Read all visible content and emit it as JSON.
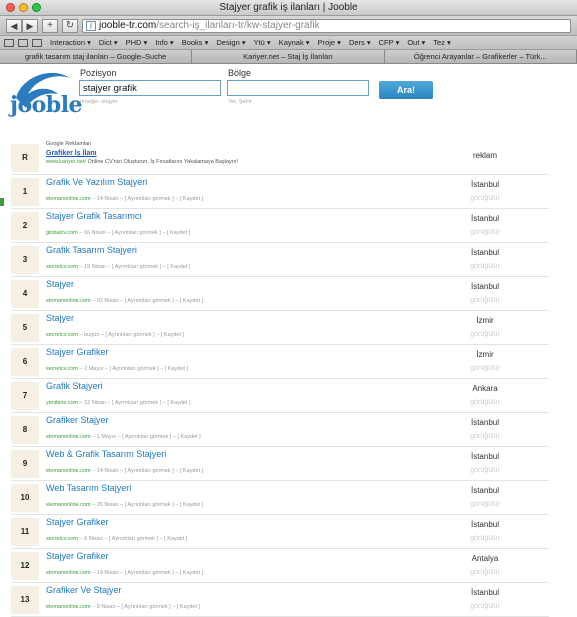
{
  "window": {
    "title": "Stajyer grafik iş ilanları | Jooble"
  },
  "toolbar": {
    "url_domain": "jooble-tr.com",
    "url_path": "/search-iş_ilanları-tr/kw-stajyer-grafik",
    "back": "◀",
    "forward": "▶",
    "add": "+",
    "reload": "↻"
  },
  "bookmarks": [
    "Interaction ▾",
    "Dict ▾",
    "PHD ▾",
    "Info ▾",
    "Books ▾",
    "Design ▾",
    "Ytü ▾",
    "Kaynak ▾",
    "Proje ▾",
    "Ders ▾",
    "CFP ▾",
    "Out ▾",
    "Tez ▾"
  ],
  "tabs": [
    "grafik tasarım staj ilanları – Google–Suche",
    "Kariyer.net – Staj İş İlanları",
    "Öğrenci Arayanlar – Grafikerler – Türk..."
  ],
  "search": {
    "position_label": "Pozisyon",
    "position_value": "stajyer grafik",
    "position_hint": "örneğin: stajyer",
    "region_label": "Bölge",
    "region_value": "",
    "region_hint": "Yer, Şehir",
    "button": "Ara!"
  },
  "ad": {
    "num": "R",
    "head": "Google Reklamları",
    "title": "Grafiker İş İlanı",
    "src": "www.kariyer.net/",
    "desc": "Online CV'nizi Oluşturun, İş Fırsatlarını Yakalamaya Başlayın!",
    "city": "reklam"
  },
  "results": [
    {
      "num": "1",
      "title": "Grafik Ve Yazılım Stajyeri",
      "src": "elemanonline.com",
      "date": "14 Nisan",
      "details": "[ Ayrıntıları görmek ]",
      "save": "[ Kaydet ]",
      "city": "İstanbul",
      "seen": "görüğülür"
    },
    {
      "num": "2",
      "title": "Stajyer Grafik Tasarımcı",
      "src": "globalcv.com",
      "date": "16 Nisan",
      "details": "[ Ayrıntıları görmek ]",
      "save": "[ Kaydet ]",
      "city": "İstanbul",
      "seen": "görüğülür"
    },
    {
      "num": "3",
      "title": "Grafik Tasarım Stajyeri",
      "src": "secretcv.com",
      "date": "15 Nisan",
      "details": "[ Ayrıntıları görmek ]",
      "save": "[ Kaydet ]",
      "city": "İstanbul",
      "seen": "görüğülür"
    },
    {
      "num": "4",
      "title": "Stajyer",
      "src": "elemanonline.com",
      "date": "02 Nisan",
      "details": "[ Ayrıntıları görmek ]",
      "save": "[ Kaydet ]",
      "city": "İstanbul",
      "seen": "görüğülür"
    },
    {
      "num": "5",
      "title": "Stajyer",
      "src": "secretcv.com",
      "date": "bugün",
      "details": "[ Ayrıntıları görmek ]",
      "save": "[ Kaydet ]",
      "city": "İzmir",
      "seen": "görüğülür"
    },
    {
      "num": "6",
      "title": "Stajyer Grafiker",
      "src": "secretcv.com",
      "date": "2 Mayıs",
      "details": "[ Ayrıntıları görmek ]",
      "save": "[ Kaydet ]",
      "city": "İzmir",
      "seen": "görüğülür"
    },
    {
      "num": "7",
      "title": "Grafik Stajyeri",
      "src": "yenibiris.com",
      "date": "12 Nisan",
      "details": "[ Ayrıntıları görmek ]",
      "save": "[ Kaydet ]",
      "city": "Ankara",
      "seen": "görüğülür"
    },
    {
      "num": "8",
      "title": "Grafiker Stajyer",
      "src": "elemanonline.com",
      "date": "1 Mayıs",
      "details": "[ Ayrıntıları görmek ]",
      "save": "[ Kaydet ]",
      "city": "İstanbul",
      "seen": "görüğülür"
    },
    {
      "num": "9",
      "title": "Web & Grafik Tasarım Stajyeri",
      "src": "elemanonline.com",
      "date": "14 Nisan",
      "details": "[ Ayrıntıları görmek ]",
      "save": "[ Kaydet ]",
      "city": "İstanbul",
      "seen": "görüğülür"
    },
    {
      "num": "10",
      "title": "Web Tasarım Stajyeri",
      "src": "elemanonline.com",
      "date": "26 Nisan",
      "details": "[ Ayrıntıları görmek ]",
      "save": "[ Kaydet ]",
      "city": "İstanbul",
      "seen": "görüğülür"
    },
    {
      "num": "11",
      "title": "Stajyer Grafiker",
      "src": "secretcv.com",
      "date": "6 Nisan",
      "details": "[ Ayrıntıları görmek ]",
      "save": "[ Kaydet ]",
      "city": "İstanbul",
      "seen": "görüğülür"
    },
    {
      "num": "12",
      "title": "Stajyer Grafiker",
      "src": "elemanonline.com",
      "date": "14 Nisan",
      "details": "[ Ayrıntıları görmek ]",
      "save": "[ Kaydet ]",
      "city": "Antalya",
      "seen": "görüğülür"
    },
    {
      "num": "13",
      "title": "Grafiker Ve Stajyer",
      "src": "elemanonline.com",
      "date": "8 Nisan",
      "details": "[ Ayrıntıları görmek ]",
      "save": "[ Kaydet ]",
      "city": "İstanbul",
      "seen": "görüğülür"
    }
  ],
  "brand": {
    "logo": "jooble"
  },
  "colors": {
    "accent": "#1f78c4",
    "source_green": "#3a9a3a",
    "number_bg": "#f5f0e3"
  }
}
